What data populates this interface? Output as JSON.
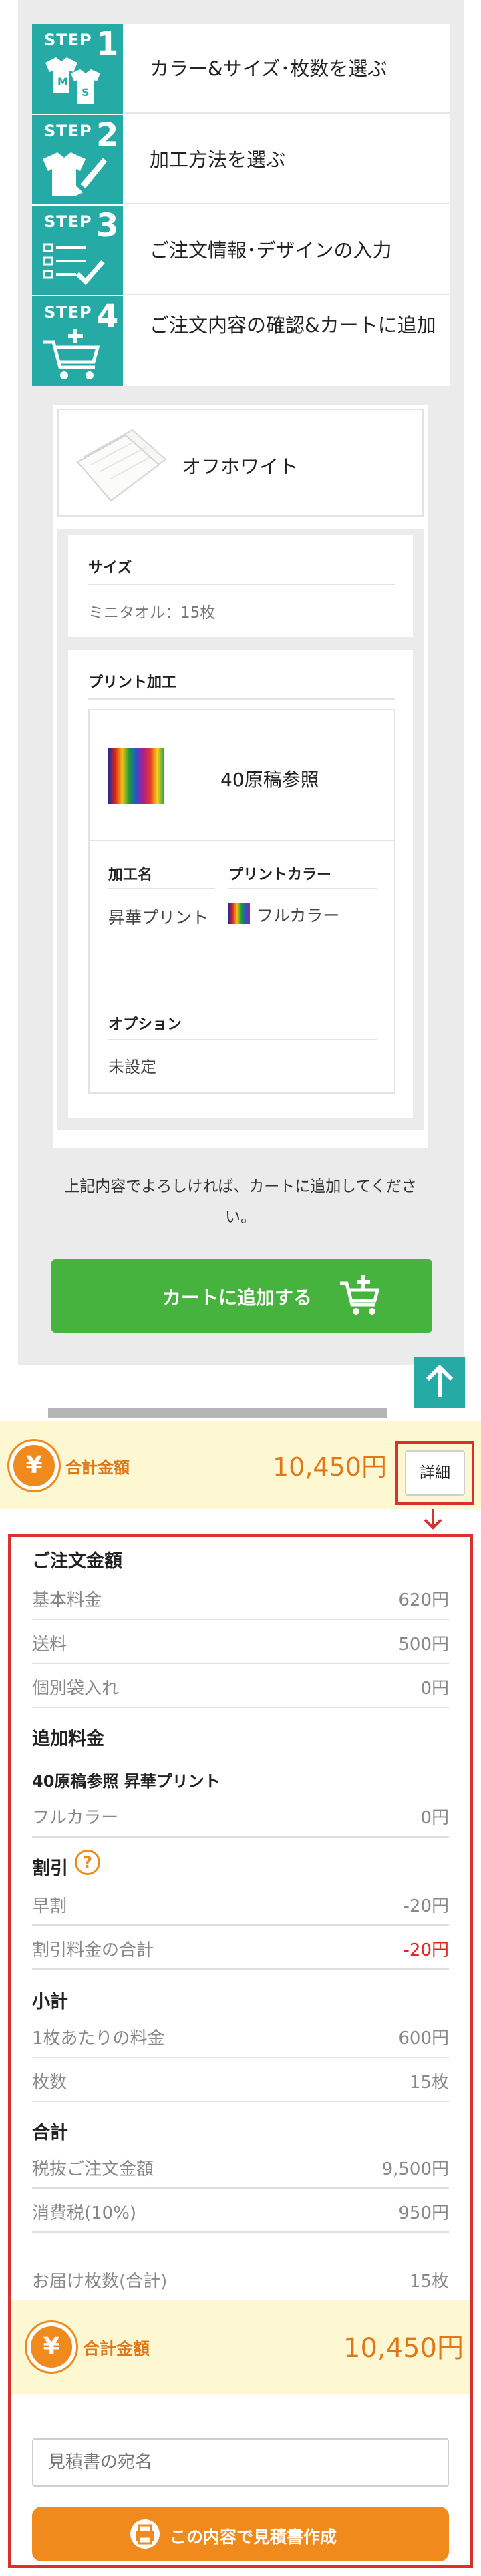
{
  "steps": [
    {
      "prefix": "STEP",
      "num": "1",
      "label": "カラー&サイズ･枚数を選ぶ",
      "icon": "tshirts-icon"
    },
    {
      "prefix": "STEP",
      "num": "2",
      "label": "加工方法を選ぶ",
      "icon": "tshirt-brush-icon"
    },
    {
      "prefix": "STEP",
      "num": "3",
      "label": "ご注文情報･デザインの入力",
      "icon": "checklist-icon"
    },
    {
      "prefix": "STEP",
      "num": "4",
      "label": "ご注文内容の確認&カートに追加",
      "icon": "cart-icon"
    }
  ],
  "product": {
    "color_name": "オフホワイト",
    "size_title": "サイズ",
    "size_value": "ミニタオル：15枚",
    "print_title": "プリント加工",
    "design_name": "40原稿参照",
    "col_process": "加工名",
    "col_color": "プリントカラー",
    "process_value": "昇華プリント",
    "color_value": "フルカラー",
    "option_title": "オプション",
    "option_value": "未設定"
  },
  "confirm": {
    "message": "上記内容でよろしければ、カートに追加してください。",
    "cart_button": "カートに追加する"
  },
  "total_bar": {
    "yen_symbol": "¥",
    "label": "合計金額",
    "amount": "10,450円",
    "detail_button": "詳細"
  },
  "summary": {
    "order_title": "ご注文金額",
    "base_label": "基本料金",
    "base_value": "620円",
    "ship_label": "送料",
    "ship_value": "500円",
    "bag_label": "個別袋入れ",
    "bag_value": "0円",
    "extra_title": "追加料金",
    "extra_item": "40原稿参照 昇華プリント",
    "fullcolor_label": "フルカラー",
    "fullcolor_value": "0円",
    "discount_title": "割引",
    "early_label": "早割",
    "early_value": "-20円",
    "disc_total_label": "割引料金の合計",
    "disc_total_value": "-20円",
    "subtotal_title": "小計",
    "per_label": "1枚あたりの料金",
    "per_value": "600円",
    "qty_label": "枚数",
    "qty_value": "15枚",
    "total_title": "合計",
    "pretax_label": "税抜ご注文金額",
    "pretax_value": "9,500円",
    "tax_label": "消費税(10%)",
    "tax_value": "950円",
    "delivery_label": "お届け枚数(合計)",
    "delivery_value": "15枚",
    "grand_label": "合計金額",
    "grand_value": "10,450円",
    "estimate_placeholder": "見積書の宛名",
    "estimate_button": "この内容で見積書作成"
  },
  "colors": {
    "teal": "#26aaa5",
    "green": "#46b33e",
    "orange": "#f08a1c",
    "red": "#d9322e",
    "cream": "#fdf8d2"
  }
}
